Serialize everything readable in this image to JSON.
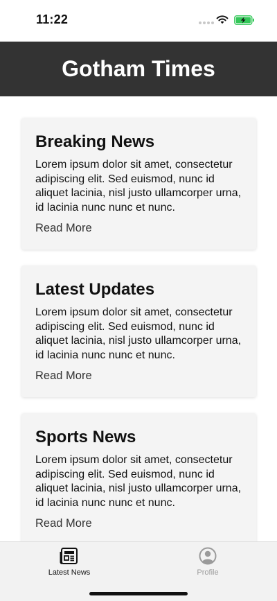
{
  "status_bar": {
    "time": "11:22"
  },
  "header": {
    "title": "Gotham Times"
  },
  "cards": [
    {
      "title": "Breaking News",
      "body": "Lorem ipsum dolor sit amet, consectetur adipiscing elit. Sed euismod, nunc id aliquet lacinia, nisl justo ullamcorper urna, id lacinia nunc nunc et nunc.",
      "link": "Read More"
    },
    {
      "title": "Latest Updates",
      "body": "Lorem ipsum dolor sit amet, consectetur adipiscing elit. Sed euismod, nunc id aliquet lacinia, nisl justo ullamcorper urna, id lacinia nunc nunc et nunc.",
      "link": "Read More"
    },
    {
      "title": "Sports News",
      "body": "Lorem ipsum dolor sit amet, consectetur adipiscing elit. Sed euismod, nunc id aliquet lacinia, nisl justo ullamcorper urna, id lacinia nunc nunc et nunc.",
      "link": "Read More"
    }
  ],
  "tab_bar": {
    "items": [
      {
        "label": "Latest News",
        "icon": "newspaper-icon",
        "active": true
      },
      {
        "label": "Profile",
        "icon": "user-circle-icon",
        "active": false
      }
    ]
  },
  "colors": {
    "header_bg": "#333333",
    "card_bg": "#f4f4f4",
    "tab_bar_bg": "#f2f2f2",
    "active_tab": "#111111",
    "inactive_tab": "#9a9a9a",
    "battery_fill": "#34c759"
  }
}
